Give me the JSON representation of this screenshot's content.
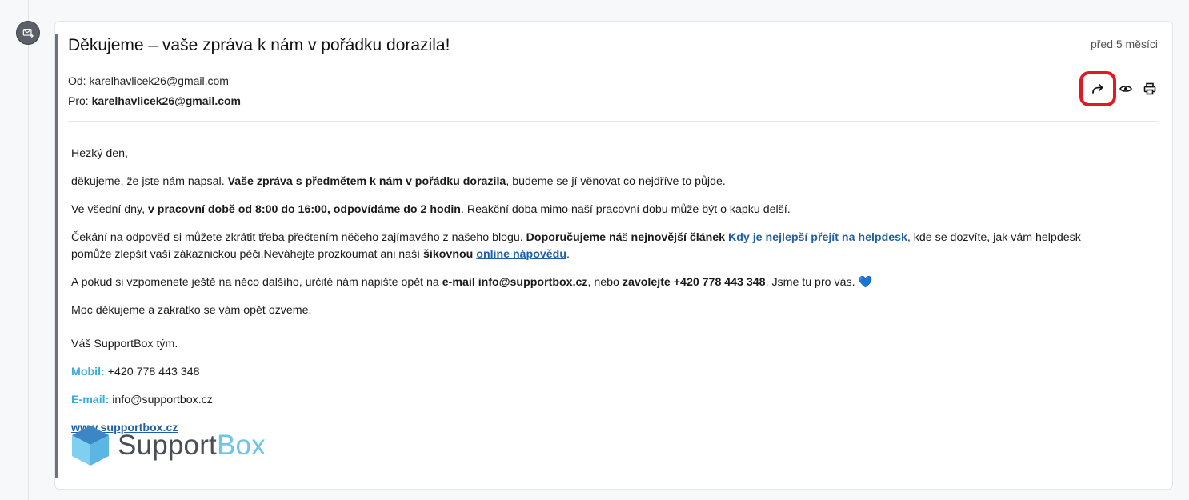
{
  "message": {
    "subject": "Děkujeme – vaše zpráva k nám v pořádku dorazila!",
    "time": "před 5 měsíci",
    "from_label": "Od:",
    "from_value": "karelhavlicek26@gmail.com",
    "to_label": "Pro:",
    "to_value": "karelhavlicek26@gmail.com"
  },
  "actions": {
    "icons": [
      "forward-icon",
      "eye-icon",
      "print-icon"
    ]
  },
  "body": {
    "greeting": "Hezký den,",
    "p1_a": "děkujeme, že jste nám napsal. ",
    "p1_b": "Vaše zpráva s předmětem k nám v pořádku dorazila",
    "p1_c": ", budeme se jí věnovat co nejdříve to půjde.",
    "p2_a": "Ve všední dny, ",
    "p2_b": "v pracovní době od 8:00 do 16:00, odpovídáme do 2 hodin",
    "p2_c": ". Reakční doba mimo naší pracovní dobu může být o kapku delší.",
    "p3_a": "Čekání na odpověď si můžete zkrátit třeba přečtením něčeho zajímavého z našeho blogu. ",
    "p3_b": "Doporučujeme ná",
    "p3_c": "š ",
    "p3_d": "nejnovější článek",
    "p3_e": " ",
    "p3_link1": "Kdy je nejlepší přejít na helpdesk",
    "p3_f": ", kde se dozvíte, jak vám helpdesk pomůže zlepšit vaší zákaznickou péči.Neváhejte prozkoumat ani naší ",
    "p3_g": "šikovnou",
    "p3_h": " ",
    "p3_link2": "online nápovědu",
    "p3_i": ".",
    "p4_a": "A pokud si vzpomenete ještě na něco dalšího, určitě nám napište opět na ",
    "p4_b": "e-mail info@supportbox.cz",
    "p4_c": ", nebo ",
    "p4_d": "zavolejte +420 778 443 348",
    "p4_e": ". Jsme tu pro vás. ",
    "p4_heart": "💙",
    "p5": "Moc děkujeme a zakrátko se vám opět ozveme.",
    "sign_off": "Váš SupportBox tým."
  },
  "signature": {
    "mobile_label": "Mobil:",
    "mobile_value": " +420 778 443 348",
    "email_label": "E-mail:",
    "email_value": " info@supportbox.cz",
    "website": "www.supportbox.cz",
    "logo_part1": "Support",
    "logo_part2": "Box"
  },
  "colors": {
    "accent_link": "#1f5fa8",
    "signature_label": "#3eaad6",
    "highlight_ring": "#e01a22",
    "logo_cube_top": "#3d86c6",
    "logo_cube_left": "#7fd0f0",
    "logo_cube_right": "#5bb6e4"
  }
}
